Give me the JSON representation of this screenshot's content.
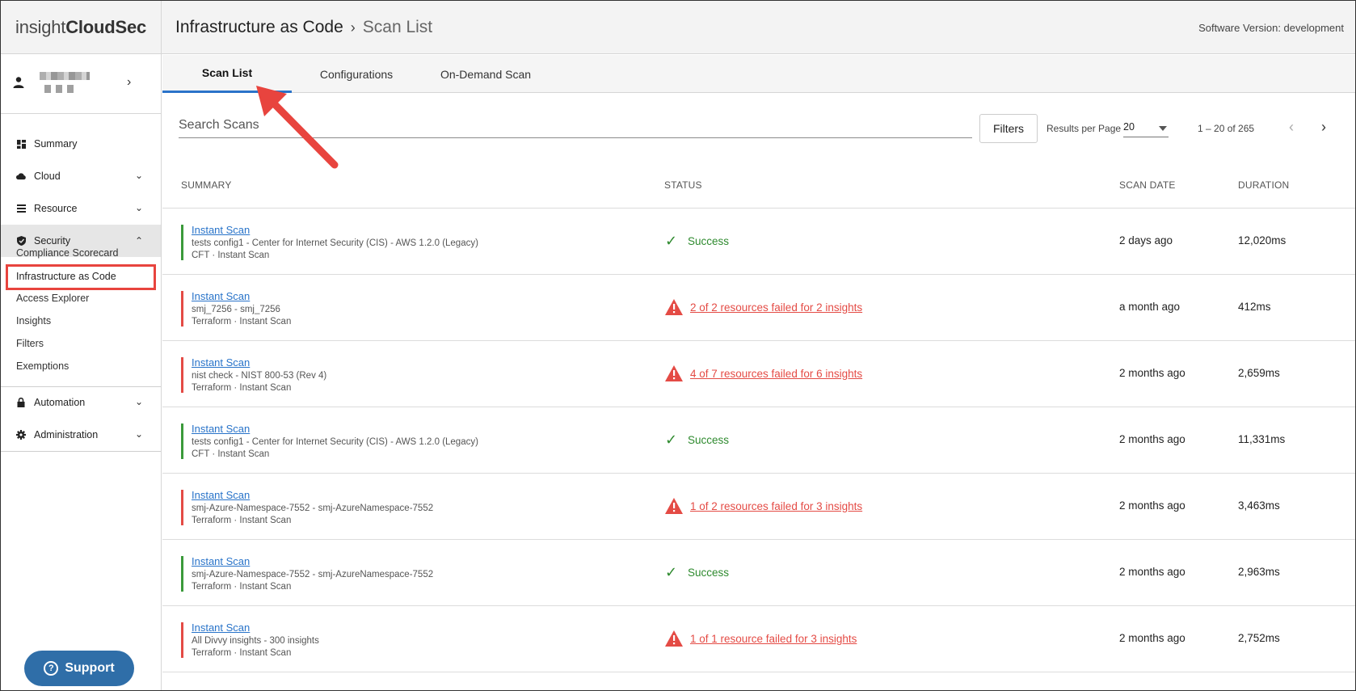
{
  "brand": {
    "part1": "insight",
    "part2": "CloudSec"
  },
  "breadcrumb": {
    "section": "Infrastructure as Code",
    "page": "Scan List"
  },
  "version": "Software Version: development",
  "sidebar": {
    "items": [
      {
        "label": "Summary",
        "icon": "dashboard-icon"
      },
      {
        "label": "Cloud",
        "icon": "cloud-icon"
      },
      {
        "label": "Resource",
        "icon": "list-icon"
      },
      {
        "label": "Security",
        "icon": "shield-icon"
      },
      {
        "label": "Automation",
        "icon": "lock-icon"
      },
      {
        "label": "Administration",
        "icon": "gear-icon"
      }
    ],
    "security_sub": [
      "Compliance Scorecard",
      "Infrastructure as Code",
      "Access Explorer",
      "Insights",
      "Filters",
      "Exemptions"
    ]
  },
  "support": {
    "label": "Support"
  },
  "tabs": [
    "Scan List",
    "Configurations",
    "On-Demand Scan"
  ],
  "toolbar": {
    "search_placeholder": "Search Scans",
    "filters_label": "Filters",
    "rpp_label": "Results per Page",
    "rpp_value": "20",
    "page_range": "1 – 20 of 265"
  },
  "table": {
    "headers": {
      "summary": "SUMMARY",
      "status": "STATUS",
      "date": "SCAN DATE",
      "duration": "DURATION"
    },
    "rows": [
      {
        "title": "Instant Scan",
        "line2": "tests config1 - Center for Internet Security (CIS) - AWS 1.2.0 (Legacy)",
        "line3": "CFT · Instant Scan",
        "state": "ok",
        "status": "Success",
        "date": "2 days ago",
        "duration": "12,020ms"
      },
      {
        "title": "Instant Scan",
        "line2": "smj_7256 - smj_7256",
        "line3": "Terraform · Instant Scan",
        "state": "fail",
        "status": "2 of 2 resources failed for 2 insights",
        "date": "a month ago",
        "duration": "412ms"
      },
      {
        "title": "Instant Scan",
        "line2": "nist check - NIST 800-53 (Rev 4)",
        "line3": "Terraform · Instant Scan",
        "state": "fail",
        "status": "4 of 7 resources failed for 6 insights",
        "date": "2 months ago",
        "duration": "2,659ms"
      },
      {
        "title": "Instant Scan",
        "line2": "tests config1 - Center for Internet Security (CIS) - AWS 1.2.0 (Legacy)",
        "line3": "CFT · Instant Scan",
        "state": "ok",
        "status": "Success",
        "date": "2 months ago",
        "duration": "11,331ms"
      },
      {
        "title": "Instant Scan",
        "line2": "smj-Azure-Namespace-7552 - smj-AzureNamespace-7552",
        "line3": "Terraform · Instant Scan",
        "state": "fail",
        "status": "1 of 2 resources failed for 3 insights",
        "date": "2 months ago",
        "duration": "3,463ms"
      },
      {
        "title": "Instant Scan",
        "line2": "smj-Azure-Namespace-7552 - smj-AzureNamespace-7552",
        "line3": "Terraform · Instant Scan",
        "state": "ok",
        "status": "Success",
        "date": "2 months ago",
        "duration": "2,963ms"
      },
      {
        "title": "Instant Scan",
        "line2": "All Divvy insights - 300 insights",
        "line3": "Terraform · Instant Scan",
        "state": "fail",
        "status": "1 of 1 resource failed for 3 insights",
        "date": "2 months ago",
        "duration": "2,752ms"
      }
    ]
  },
  "colors": {
    "accent": "#2b73c9",
    "success": "#2e8a2e",
    "fail": "#e44b45",
    "annotation": "#e8443e"
  }
}
